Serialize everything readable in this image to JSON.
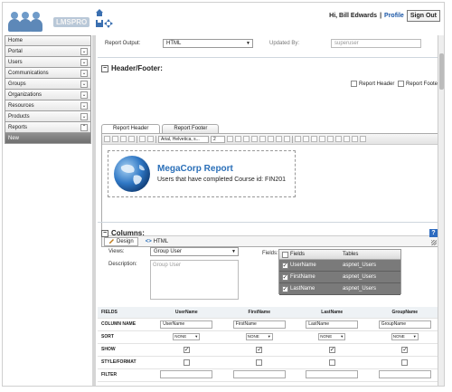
{
  "header": {
    "logo_text": "LMSPRO",
    "greeting": "Hi, Bill Edwards",
    "separator": "|",
    "profile_link": "Profile",
    "signout_label": "Sign Out"
  },
  "sidebar": {
    "items": [
      {
        "label": "Home"
      },
      {
        "label": "Portal"
      },
      {
        "label": "Users"
      },
      {
        "label": "Communications"
      },
      {
        "label": "Groups"
      },
      {
        "label": "Organizations"
      },
      {
        "label": "Resources"
      },
      {
        "label": "Products"
      },
      {
        "label": "Reports"
      },
      {
        "label": "New"
      }
    ]
  },
  "main": {
    "report_output_label": "Report Output:",
    "report_output_value": "HTML",
    "updated_by_label": "Updated By:",
    "updated_by_value": "superuser",
    "header_footer_title": "Header/Footer:",
    "report_header_cb": "Report Header",
    "report_footer_cb": "Report Footer",
    "tab_report_header": "Report Header",
    "tab_report_footer": "Report Footer",
    "font_select": "Arial, Helvetica, s...",
    "size_select": "2",
    "report_title": "MegaCorp Report",
    "report_subtitle": "Users that have completed Course id: FIN201",
    "design_tab": "Design",
    "html_tab": "HTML",
    "columns_title": "Columns:",
    "help_label": "?",
    "views_label": "Views:",
    "views_value": "Group User",
    "description_label": "Description:",
    "description_placeholder": "Group User",
    "fields_label": "Fields:",
    "fields_grid": {
      "col_fields": "Fields",
      "col_tables": "Tables",
      "rows": [
        {
          "field": "UserName",
          "table": "aspnet_Users"
        },
        {
          "field": "FirstName",
          "table": "aspnet_Users"
        },
        {
          "field": "LastName",
          "table": "aspnet_Users"
        }
      ]
    },
    "fields_table": {
      "head_label": "FIELDS",
      "columns": [
        "UserName",
        "FirstName",
        "LastName",
        "GroupName"
      ],
      "row_column_name": "COLUMN NAME",
      "row_sort": "SORT",
      "row_show": "SHOW",
      "row_style": "STYLE/FORMAT",
      "row_filter": "FILTER",
      "sort_value": "NONE"
    }
  },
  "colors": {
    "accent": "#2a6fb8",
    "sidebar_active": "#7a7a7a"
  }
}
